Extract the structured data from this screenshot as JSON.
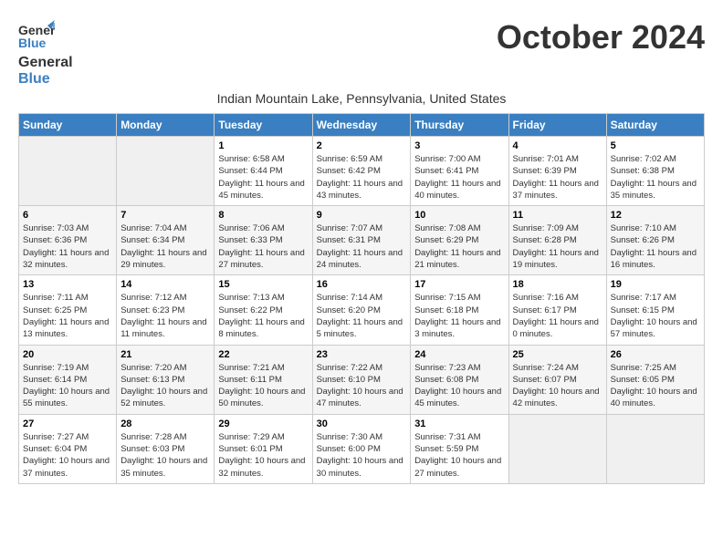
{
  "header": {
    "logo_line1": "General",
    "logo_line2": "Blue",
    "month_title": "October 2024",
    "subtitle": "Indian Mountain Lake, Pennsylvania, United States"
  },
  "days_of_week": [
    "Sunday",
    "Monday",
    "Tuesday",
    "Wednesday",
    "Thursday",
    "Friday",
    "Saturday"
  ],
  "weeks": [
    {
      "days": [
        {
          "number": "",
          "info": ""
        },
        {
          "number": "",
          "info": ""
        },
        {
          "number": "1",
          "info": "Sunrise: 6:58 AM\nSunset: 6:44 PM\nDaylight: 11 hours and 45 minutes."
        },
        {
          "number": "2",
          "info": "Sunrise: 6:59 AM\nSunset: 6:42 PM\nDaylight: 11 hours and 43 minutes."
        },
        {
          "number": "3",
          "info": "Sunrise: 7:00 AM\nSunset: 6:41 PM\nDaylight: 11 hours and 40 minutes."
        },
        {
          "number": "4",
          "info": "Sunrise: 7:01 AM\nSunset: 6:39 PM\nDaylight: 11 hours and 37 minutes."
        },
        {
          "number": "5",
          "info": "Sunrise: 7:02 AM\nSunset: 6:38 PM\nDaylight: 11 hours and 35 minutes."
        }
      ]
    },
    {
      "days": [
        {
          "number": "6",
          "info": "Sunrise: 7:03 AM\nSunset: 6:36 PM\nDaylight: 11 hours and 32 minutes."
        },
        {
          "number": "7",
          "info": "Sunrise: 7:04 AM\nSunset: 6:34 PM\nDaylight: 11 hours and 29 minutes."
        },
        {
          "number": "8",
          "info": "Sunrise: 7:06 AM\nSunset: 6:33 PM\nDaylight: 11 hours and 27 minutes."
        },
        {
          "number": "9",
          "info": "Sunrise: 7:07 AM\nSunset: 6:31 PM\nDaylight: 11 hours and 24 minutes."
        },
        {
          "number": "10",
          "info": "Sunrise: 7:08 AM\nSunset: 6:29 PM\nDaylight: 11 hours and 21 minutes."
        },
        {
          "number": "11",
          "info": "Sunrise: 7:09 AM\nSunset: 6:28 PM\nDaylight: 11 hours and 19 minutes."
        },
        {
          "number": "12",
          "info": "Sunrise: 7:10 AM\nSunset: 6:26 PM\nDaylight: 11 hours and 16 minutes."
        }
      ]
    },
    {
      "days": [
        {
          "number": "13",
          "info": "Sunrise: 7:11 AM\nSunset: 6:25 PM\nDaylight: 11 hours and 13 minutes."
        },
        {
          "number": "14",
          "info": "Sunrise: 7:12 AM\nSunset: 6:23 PM\nDaylight: 11 hours and 11 minutes."
        },
        {
          "number": "15",
          "info": "Sunrise: 7:13 AM\nSunset: 6:22 PM\nDaylight: 11 hours and 8 minutes."
        },
        {
          "number": "16",
          "info": "Sunrise: 7:14 AM\nSunset: 6:20 PM\nDaylight: 11 hours and 5 minutes."
        },
        {
          "number": "17",
          "info": "Sunrise: 7:15 AM\nSunset: 6:18 PM\nDaylight: 11 hours and 3 minutes."
        },
        {
          "number": "18",
          "info": "Sunrise: 7:16 AM\nSunset: 6:17 PM\nDaylight: 11 hours and 0 minutes."
        },
        {
          "number": "19",
          "info": "Sunrise: 7:17 AM\nSunset: 6:15 PM\nDaylight: 10 hours and 57 minutes."
        }
      ]
    },
    {
      "days": [
        {
          "number": "20",
          "info": "Sunrise: 7:19 AM\nSunset: 6:14 PM\nDaylight: 10 hours and 55 minutes."
        },
        {
          "number": "21",
          "info": "Sunrise: 7:20 AM\nSunset: 6:13 PM\nDaylight: 10 hours and 52 minutes."
        },
        {
          "number": "22",
          "info": "Sunrise: 7:21 AM\nSunset: 6:11 PM\nDaylight: 10 hours and 50 minutes."
        },
        {
          "number": "23",
          "info": "Sunrise: 7:22 AM\nSunset: 6:10 PM\nDaylight: 10 hours and 47 minutes."
        },
        {
          "number": "24",
          "info": "Sunrise: 7:23 AM\nSunset: 6:08 PM\nDaylight: 10 hours and 45 minutes."
        },
        {
          "number": "25",
          "info": "Sunrise: 7:24 AM\nSunset: 6:07 PM\nDaylight: 10 hours and 42 minutes."
        },
        {
          "number": "26",
          "info": "Sunrise: 7:25 AM\nSunset: 6:05 PM\nDaylight: 10 hours and 40 minutes."
        }
      ]
    },
    {
      "days": [
        {
          "number": "27",
          "info": "Sunrise: 7:27 AM\nSunset: 6:04 PM\nDaylight: 10 hours and 37 minutes."
        },
        {
          "number": "28",
          "info": "Sunrise: 7:28 AM\nSunset: 6:03 PM\nDaylight: 10 hours and 35 minutes."
        },
        {
          "number": "29",
          "info": "Sunrise: 7:29 AM\nSunset: 6:01 PM\nDaylight: 10 hours and 32 minutes."
        },
        {
          "number": "30",
          "info": "Sunrise: 7:30 AM\nSunset: 6:00 PM\nDaylight: 10 hours and 30 minutes."
        },
        {
          "number": "31",
          "info": "Sunrise: 7:31 AM\nSunset: 5:59 PM\nDaylight: 10 hours and 27 minutes."
        },
        {
          "number": "",
          "info": ""
        },
        {
          "number": "",
          "info": ""
        }
      ]
    }
  ]
}
